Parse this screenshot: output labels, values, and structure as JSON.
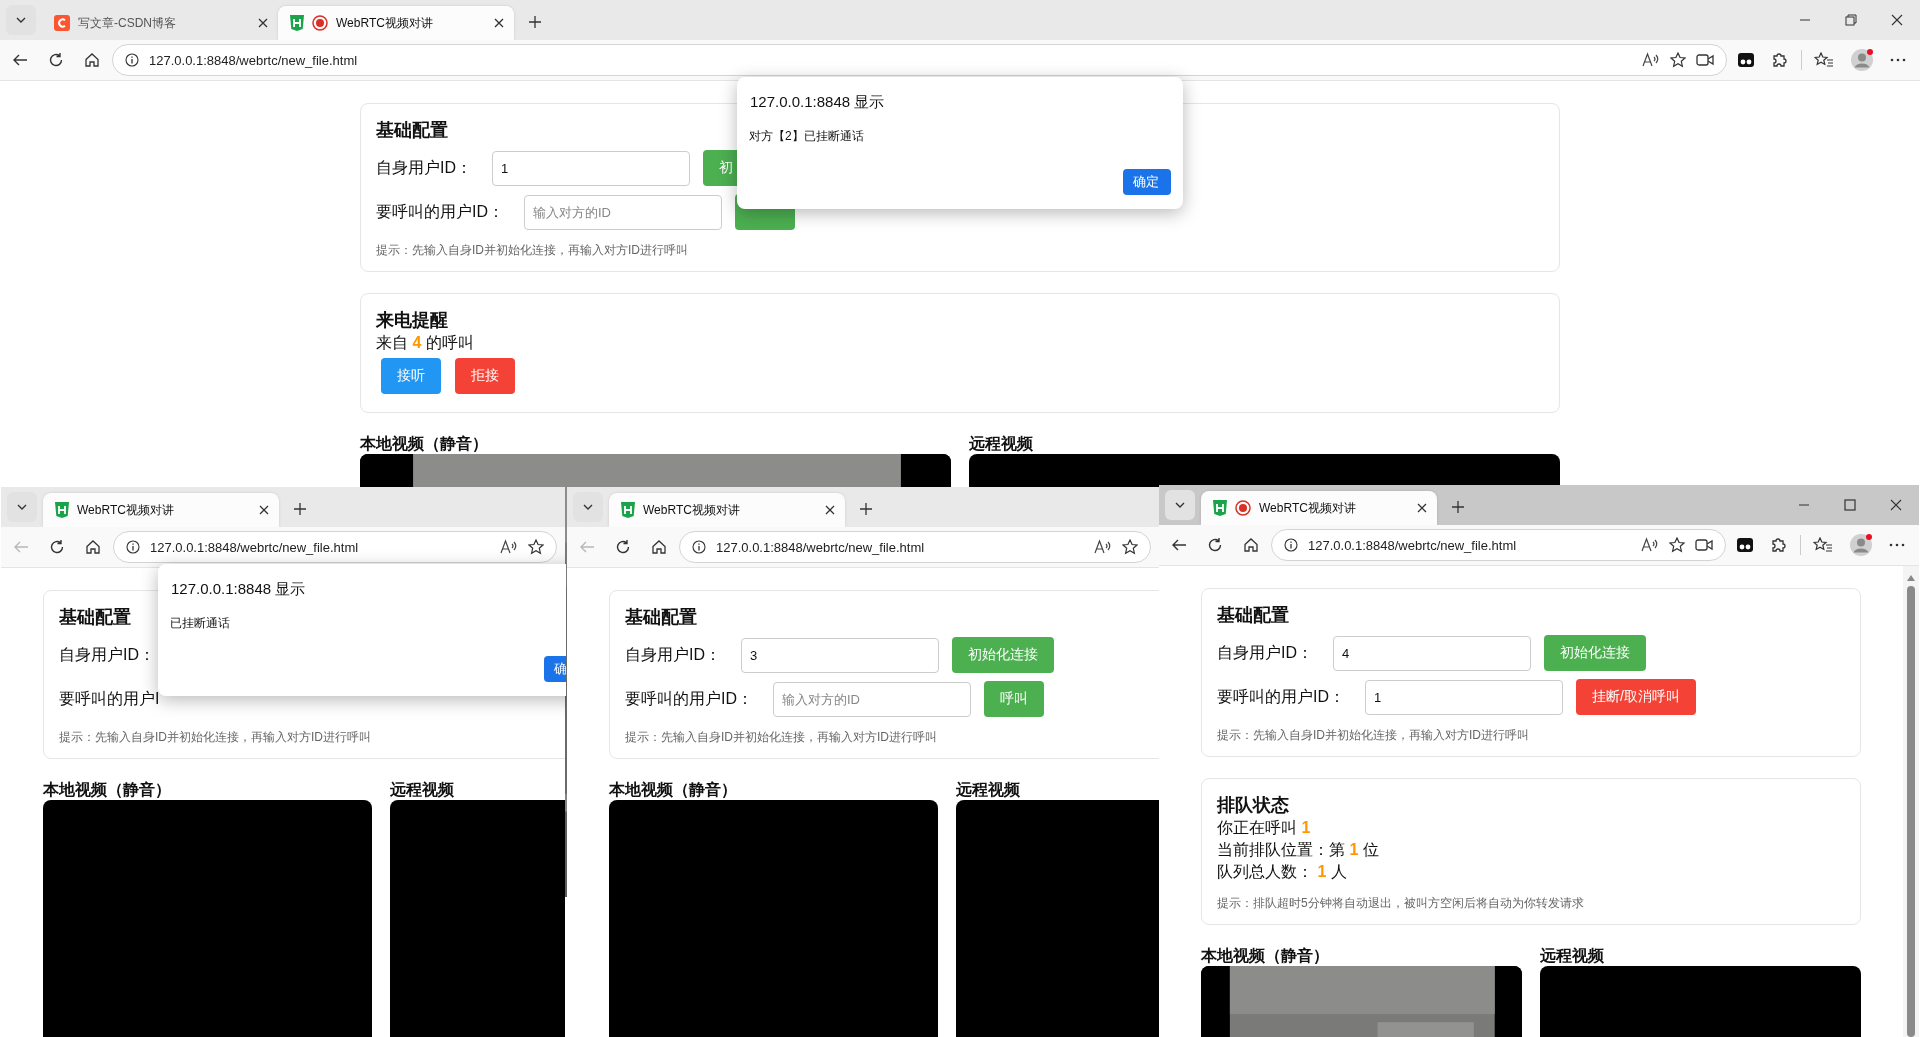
{
  "windows": [
    {
      "maximized": true,
      "controls_visible": true,
      "back_enabled": true,
      "tabs": [
        {
          "title": "写文章-CSDN博客",
          "kind": "blog",
          "selected": false
        },
        {
          "title": "WebRTC视频对讲",
          "kind": "page",
          "recording": true,
          "selected": true
        }
      ],
      "url": "127.0.0.1:8848/webrtc/new_file.html",
      "sections": [
        {
          "title": "基础配置",
          "rows": [
            {
              "label": "自身用户ID：",
              "field": {
                "value": "1"
              },
              "button": {
                "label": "初",
                "kind": "success"
              }
            },
            {
              "label": "要呼叫的用户ID：",
              "field": {
                "placeholder": "输入对方的ID"
              },
              "button": {
                "kind": "success"
              }
            }
          ],
          "hint": "提示：先输入自身ID并初始化连接，再输入对方ID进行呼叫"
        },
        {
          "title": "来电提醒",
          "lines": [
            [
              {
                "text": "来自 ",
                "highlight": false
              },
              {
                "text": "4",
                "highlight": true
              },
              {
                "text": " 的呼叫",
                "highlight": false
              }
            ]
          ],
          "buttons": [
            {
              "label": "接听",
              "kind": "info"
            },
            {
              "label": "拒接",
              "kind": "danger"
            }
          ]
        }
      ],
      "videos": [
        {
          "label": "本地视频（静音）",
          "feed": true
        },
        {
          "label": "远程视频",
          "feed": false
        }
      ],
      "dialog": {
        "title": "127.0.0.1:8848 显示",
        "message": "对方【2】已挂断通话",
        "button": "确定"
      }
    },
    {
      "back_enabled": false,
      "tabs": [
        {
          "title": "WebRTC视频对讲",
          "kind": "page",
          "selected": true
        }
      ],
      "url": "127.0.0.1:8848/webrtc/new_file.html",
      "sections": [
        {
          "title": "基础配置",
          "rows": [
            {
              "label": "自身用户ID："
            },
            {
              "label": "要呼叫的用户I"
            }
          ],
          "hint": "提示：先输入自身ID并初始化连接，再输入对方ID进行呼叫"
        }
      ],
      "videos": [
        {
          "label": "本地视频（静音）",
          "feed": false
        },
        {
          "label": "远程视频",
          "feed": false
        }
      ],
      "dialog": {
        "title": "127.0.0.1:8848 显示",
        "message": "已挂断通话",
        "button": "确"
      }
    },
    {
      "back_enabled": false,
      "tabs": [
        {
          "title": "WebRTC视频对讲",
          "kind": "page",
          "selected": true
        }
      ],
      "url": "127.0.0.1:8848/webrtc/new_file.html",
      "sections": [
        {
          "title": "基础配置",
          "rows": [
            {
              "label": "自身用户ID：",
              "field": {
                "value": "3"
              },
              "button": {
                "label": "初始化连接",
                "kind": "success"
              }
            },
            {
              "label": "要呼叫的用户ID：",
              "field": {
                "placeholder": "输入对方的ID"
              },
              "button": {
                "label": "呼叫",
                "kind": "success"
              }
            }
          ],
          "hint": "提示：先输入自身ID并初始化连接，再输入对方ID进行呼叫"
        }
      ],
      "videos": [
        {
          "label": "本地视频（静音）",
          "feed": false
        },
        {
          "label": "远程视频",
          "feed": false
        }
      ]
    },
    {
      "focused": true,
      "controls_visible": true,
      "back_enabled": true,
      "scrollbar": true,
      "tabs": [
        {
          "title": "WebRTC视频对讲",
          "kind": "page",
          "recording": true,
          "selected": true
        }
      ],
      "url": "127.0.0.1:8848/webrtc/new_file.html",
      "sections": [
        {
          "title": "基础配置",
          "rows": [
            {
              "label": "自身用户ID：",
              "field": {
                "value": "4"
              },
              "button": {
                "label": "初始化连接",
                "kind": "success"
              }
            },
            {
              "label": "要呼叫的用户ID：",
              "field": {
                "value": "1"
              },
              "button": {
                "label": "挂断/取消呼叫",
                "kind": "danger"
              }
            }
          ],
          "hint": "提示：先输入自身ID并初始化连接，再输入对方ID进行呼叫"
        },
        {
          "title": "排队状态",
          "lines": [
            [
              {
                "text": "你正在呼叫 ",
                "highlight": false
              },
              {
                "text": "1",
                "highlight": true
              }
            ],
            [
              {
                "text": "当前排队位置：第 ",
                "highlight": false
              },
              {
                "text": "1",
                "highlight": true
              },
              {
                "text": " 位",
                "highlight": false
              }
            ],
            [
              {
                "text": "队列总人数： ",
                "highlight": false
              },
              {
                "text": "1",
                "highlight": true
              },
              {
                "text": " 人",
                "highlight": false
              }
            ]
          ],
          "hint": "提示：排队超时5分钟将自动退出，被叫方空闲后将自动为你转发请求"
        }
      ],
      "videos": [
        {
          "label": "本地视频（静音）",
          "feed": true
        },
        {
          "label": "远程视频",
          "feed": false
        }
      ]
    }
  ]
}
